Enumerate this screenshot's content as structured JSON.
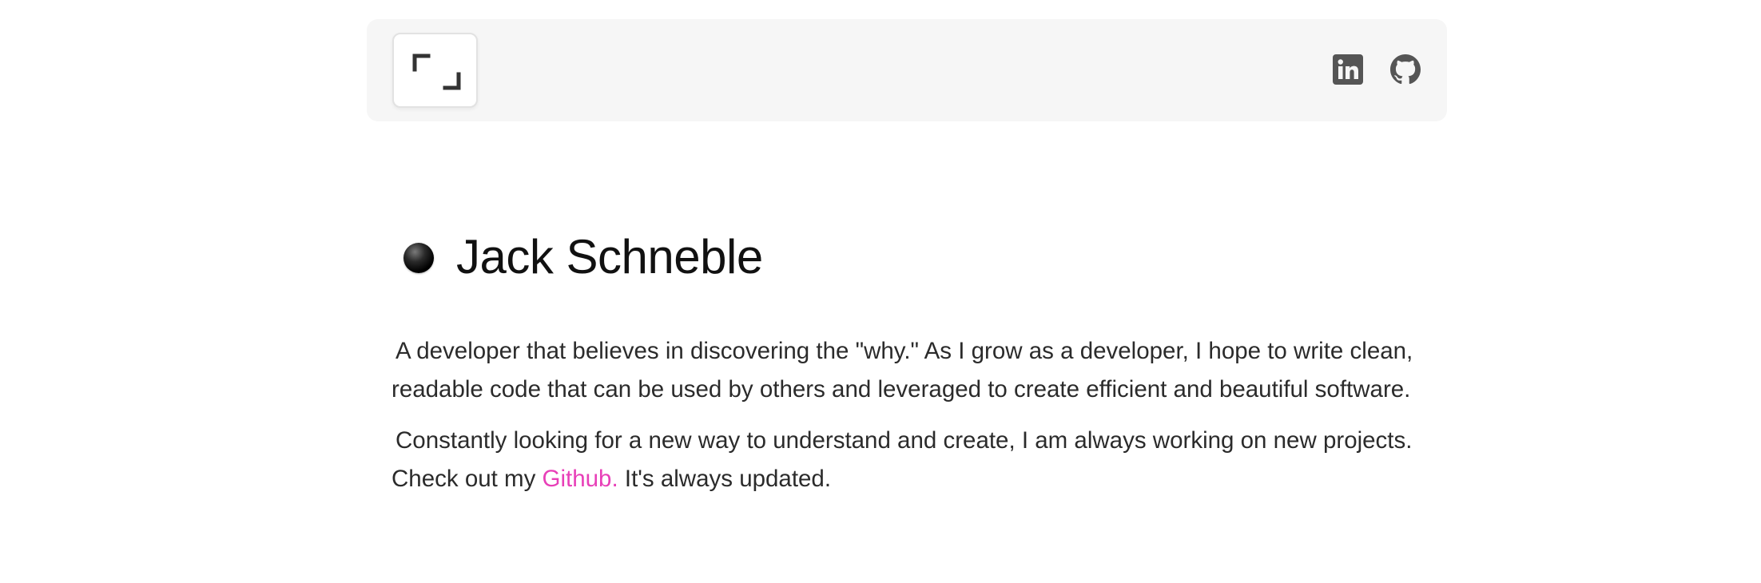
{
  "header": {
    "logo_icon": "bracket-frame-icon",
    "links": [
      {
        "name": "linkedin",
        "icon": "linkedin-icon"
      },
      {
        "name": "github",
        "icon": "github-icon"
      }
    ]
  },
  "hero": {
    "name": "Jack Schneble"
  },
  "bio": {
    "paragraph1": "A developer that believes in discovering the \"why.\" As I grow as a developer, I hope to write clean, readable code that can be used by others and leveraged to create efficient and beautiful software.",
    "paragraph2_before": "Constantly looking for a new way to understand and create, I am always working on new projects. Check out my ",
    "paragraph2_link": "Github.",
    "paragraph2_after": " It's always updated."
  },
  "colors": {
    "header_bg": "#f6f6f6",
    "link_accent": "#e83fb8",
    "icon_color": "#555555"
  }
}
